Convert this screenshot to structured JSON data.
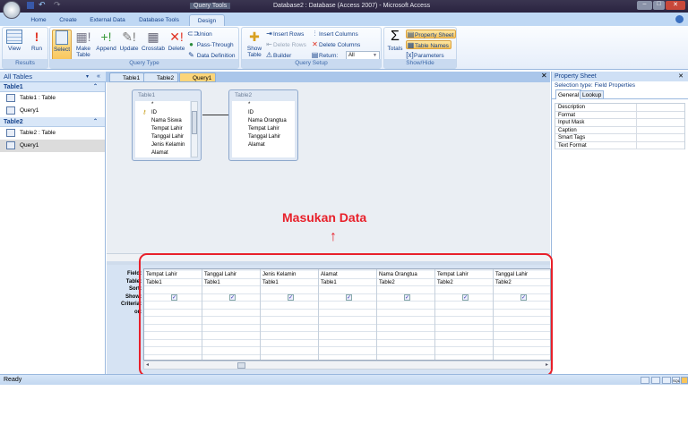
{
  "window": {
    "context_title": "Query Tools",
    "title": "Database2 : Database (Access 2007) - Microsoft Access"
  },
  "ribbon_tabs": [
    "Home",
    "Create",
    "External Data",
    "Database Tools",
    "Design"
  ],
  "ribbon": {
    "results": {
      "label": "Results",
      "view": "View",
      "run": "Run"
    },
    "query_type": {
      "label": "Query Type",
      "select": "Select",
      "make_table": "Make Table",
      "append": "Append",
      "update": "Update",
      "crosstab": "Crosstab",
      "delete": "Delete",
      "union": "Union",
      "pass_through": "Pass-Through",
      "data_definition": "Data Definition"
    },
    "query_setup": {
      "label": "Query Setup",
      "show_table": "Show Table",
      "insert_rows": "Insert Rows",
      "delete_rows": "Delete Rows",
      "builder": "Builder",
      "insert_columns": "Insert Columns",
      "delete_columns": "Delete Columns",
      "return_label": "Return:",
      "return_value": "All"
    },
    "show_hide": {
      "label": "Show/Hide",
      "totals": "Totals",
      "property_sheet": "Property Sheet",
      "table_names": "Table Names",
      "parameters": "Parameters"
    }
  },
  "nav": {
    "header": "All Tables",
    "groups": [
      {
        "name": "Table1",
        "items": [
          "Table1 : Table",
          "Query1"
        ]
      },
      {
        "name": "Table2",
        "items": [
          "Table2 : Table",
          "Query1"
        ]
      }
    ]
  },
  "doc_tabs": [
    "Table1",
    "Table2",
    "Query1"
  ],
  "tables": [
    {
      "name": "Table1",
      "fields": [
        "*",
        "ID",
        "Nama Siswa",
        "Tempat Lahir",
        "Tanggal Lahir",
        "Jenis Kelamin",
        "Alamat"
      ]
    },
    {
      "name": "Table2",
      "fields": [
        "*",
        "ID",
        "Nama Orangtua",
        "Tempat Lahir",
        "Tanggal Lahir",
        "Alamat"
      ]
    }
  ],
  "grid": {
    "row_labels": [
      "Field:",
      "Table:",
      "Sort:",
      "Show:",
      "Criteria:",
      "or:"
    ],
    "columns": [
      {
        "field": "Tempat Lahir",
        "table": "Table1",
        "show": true
      },
      {
        "field": "Tanggal Lahir",
        "table": "Table1",
        "show": true
      },
      {
        "field": "Jenis Kelamin",
        "table": "Table1",
        "show": true
      },
      {
        "field": "Alamat",
        "table": "Table1",
        "show": true
      },
      {
        "field": "Nama Orangtua",
        "table": "Table2",
        "show": true
      },
      {
        "field": "Tempat Lahir",
        "table": "Table2",
        "show": true
      },
      {
        "field": "Tanggal Lahir",
        "table": "Table2",
        "show": true
      }
    ]
  },
  "property_sheet": {
    "title": "Property Sheet",
    "selection_type": "Selection type:  Field Properties",
    "tabs": [
      "General",
      "Lookup"
    ],
    "rows": [
      "Description",
      "Format",
      "Input Mask",
      "Caption",
      "Smart Tags",
      "Text Format"
    ]
  },
  "status": {
    "text": "Ready",
    "view_sql": "SQL"
  },
  "annotation": {
    "text": "Masukan Data",
    "arrow": "↑"
  },
  "colors": {
    "accent": "#15428b",
    "annotation": "#e8202a",
    "highlight": "#f9c55a"
  }
}
